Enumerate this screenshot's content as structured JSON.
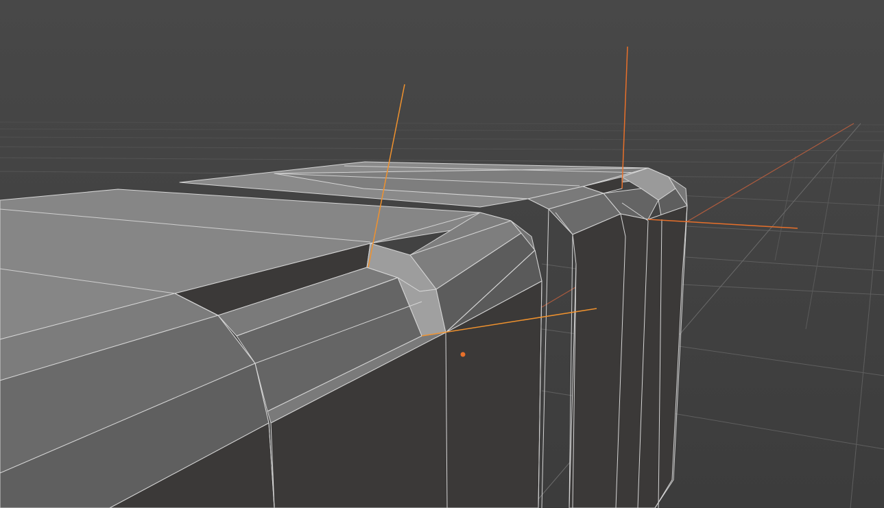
{
  "app": {
    "name": "3D viewport",
    "mode": "edit-mode"
  },
  "scene": {
    "background_top": "#4a4a4a",
    "background_bottom": "#3a3a3a",
    "grid_color": "#6a6a6a",
    "face_light": "#858585",
    "face_mid": "#6b6b6b",
    "face_dark": "#3b3938",
    "face_selected": "#9c9c9c",
    "edge_color": "#d8d8d8",
    "selection_color": "#f0922e",
    "origin_color": "#e8702a"
  },
  "gizmo": {
    "x_axis_color": "#d9603b",
    "z_axis_color": "#e8702a"
  }
}
